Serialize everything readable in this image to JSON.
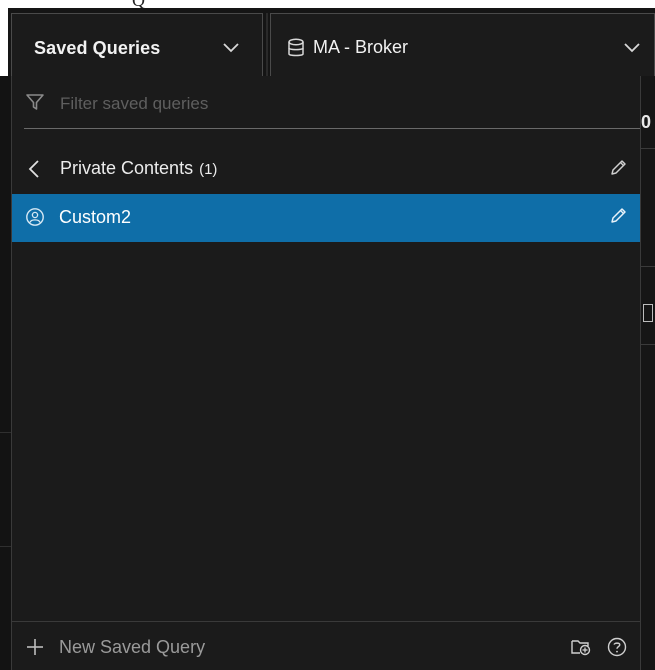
{
  "top_fragment": "Q",
  "header": {
    "saved_queries_label": "Saved Queries",
    "source_label": "MA - Broker"
  },
  "panel": {
    "filter_placeholder": "Filter saved queries",
    "group": {
      "label": "Private Contents",
      "count": "(1)"
    },
    "items": [
      {
        "label": "Custom2",
        "selected": true
      }
    ],
    "footer": {
      "new_label": "New Saved Query"
    }
  },
  "right_edge_fragment": "0",
  "icons": {
    "chevron": "chevron-down-icon",
    "database": "database-icon",
    "filter": "filter-icon",
    "back": "chevron-left-icon",
    "edit": "pencil-icon",
    "user": "user-circle-icon",
    "plus": "plus-icon",
    "folder": "folder-add-icon",
    "help": "help-circle-icon"
  },
  "colors": {
    "selected_row": "#0f6ea8",
    "panel_bg": "#1b1b1b",
    "header_bg": "#151515"
  }
}
